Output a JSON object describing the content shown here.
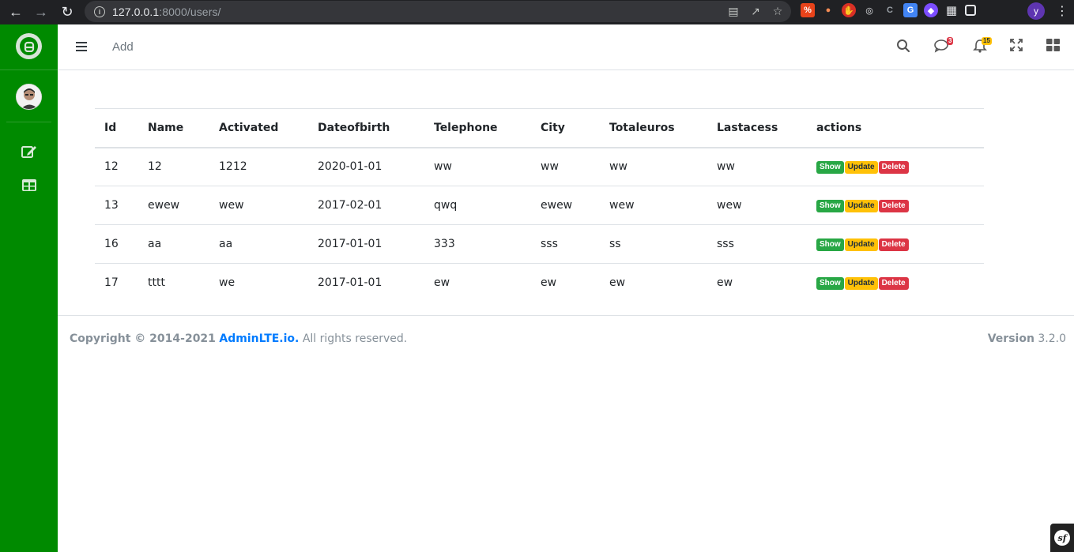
{
  "browser": {
    "url_host": "127.0.0.1",
    "url_rest": ":8000/users/",
    "profile_initial": "y"
  },
  "navbar": {
    "add_label": "Add",
    "messages_count": "3",
    "notifications_count": "15"
  },
  "table": {
    "headers": [
      "Id",
      "Name",
      "Activated",
      "Dateofbirth",
      "Telephone",
      "City",
      "Totaleuros",
      "Lastacess",
      "actions"
    ],
    "rows": [
      [
        "12",
        "12",
        "1212",
        "2020-01-01",
        "ww",
        "ww",
        "ww",
        "ww"
      ],
      [
        "13",
        "ewew",
        "wew",
        "2017-02-01",
        "qwq",
        "ewew",
        "wew",
        "wew"
      ],
      [
        "16",
        "aa",
        "aa",
        "2017-01-01",
        "333",
        "sss",
        "ss",
        "sss"
      ],
      [
        "17",
        "tttt",
        "we",
        "2017-01-01",
        "ew",
        "ew",
        "ew",
        "ew"
      ]
    ],
    "actions": {
      "show": "Show",
      "update": "Update",
      "delete": "Delete"
    }
  },
  "footer": {
    "copyright": "Copyright © 2014-2021",
    "brand_link": "AdminLTE.io.",
    "rights": "All rights reserved.",
    "version_label": "Version",
    "version_value": "3.2.0"
  },
  "colors": {
    "sidebar": "#008a00",
    "show": "#28a745",
    "update": "#ffc107",
    "delete": "#dc3545",
    "link": "#007bff"
  }
}
